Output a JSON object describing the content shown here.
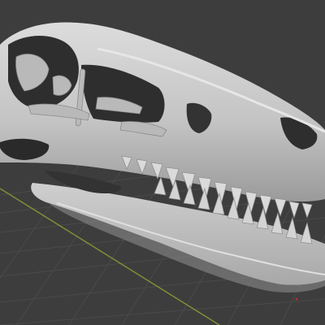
{
  "viewport": {
    "background": "#3d3d3d",
    "grid_color": "#4c4c4c",
    "x_axis_color": "#8a9a3a",
    "red_axis_color": "#b03030"
  },
  "model": {
    "name_icon": "dinosaur-skull-icon",
    "fill": "#c8c8c8",
    "shade": "#8a8a8a",
    "dark": "#2e2e2e",
    "highlight": "#e4e4e4"
  }
}
